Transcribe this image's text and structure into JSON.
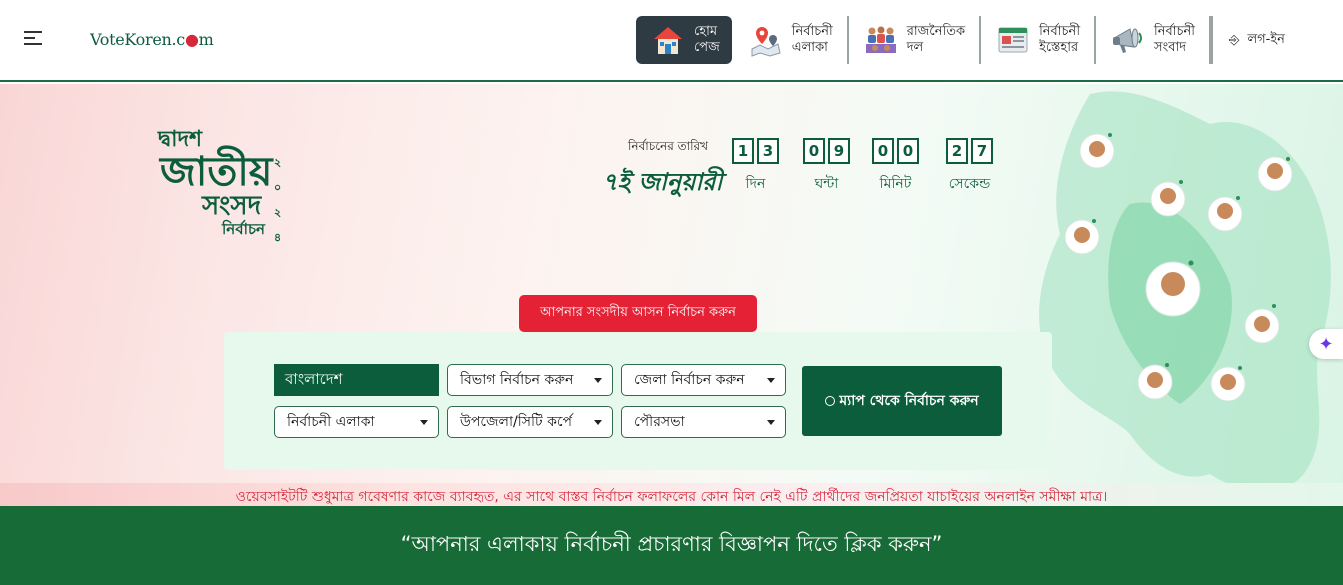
{
  "header": {
    "logo_main": "VoteKoren.c",
    "logo_dot": "●",
    "logo_end": "m",
    "nav": [
      {
        "label": "হোম\nপেজ",
        "icon": "house-icon"
      },
      {
        "label": "নির্বাচনী\nএলাকা",
        "icon": "map-pin-icon"
      },
      {
        "label": "রাজনৈতিক\nদল",
        "icon": "people-group-icon"
      },
      {
        "label": "নির্বাচনী\nইস্তেহার",
        "icon": "manifesto-document-icon"
      },
      {
        "label": "নির্বাচনী\nসংবাদ",
        "icon": "megaphone-icon"
      }
    ],
    "login_label": "লগ-ইন",
    "login_icon": "⎆"
  },
  "hero": {
    "title": {
      "line1": "দ্বাদশ",
      "line2": "জাতীয়",
      "line3": "সংসদ",
      "line4": "নির্বাচন",
      "year_digits": "২\n০\n২\n৪"
    },
    "election_date_label": "নির্বাচনের তারিখ",
    "election_date": "৭ই জানুয়ারী",
    "countdown": [
      {
        "digits": [
          "1",
          "3"
        ],
        "label": "দিন"
      },
      {
        "digits": [
          "0",
          "9"
        ],
        "label": "ঘন্টা"
      },
      {
        "digits": [
          "0",
          "0"
        ],
        "label": "মিনিট"
      },
      {
        "digits": [
          "2",
          "7"
        ],
        "label": "সেকেন্ড"
      }
    ],
    "select_seat_button": "আপনার সংসদীয় আসন নির্বাচন করুন",
    "filters": {
      "country": "বাংলাদেশ",
      "division": "বিভাগ নির্বাচন করুন",
      "district": "জেলা নির্বাচন করুন",
      "constituency": "নির্বাচনী এলাকা",
      "upazila": "উপজেলা/সিটি কর্পে",
      "municipality": "পৌরসভা"
    },
    "map_select_button": "ম্যাপ থেকে নির্বাচন করুন",
    "sparkle_icon": "✦",
    "disclaimer": "ওয়েবসাইটটি শুধুমাত্র গবেষণার কাজে ব্যাবহৃত, এর সাথে বাস্তব নির্বাচন ফলাফলের কোন মিল নেই এটি প্রার্থীদের জনপ্রিয়তা যাচাইয়ের অনলাইন সমীক্ষা মাত্র।"
  },
  "banner": {
    "text": "“আপনার এলাকায় নির্বাচনী প্রচারণার বিজ্ঞাপন দিতে ক্লিক করুন”"
  },
  "colors": {
    "brand_green": "#0b5d3c",
    "banner_green": "#176b36",
    "alert_red": "#e52135",
    "home_bg": "#2f3b43"
  }
}
